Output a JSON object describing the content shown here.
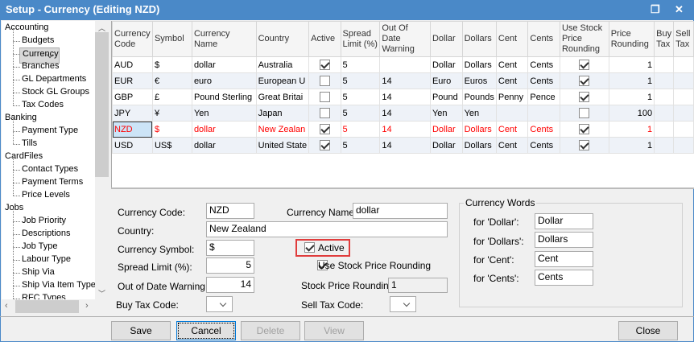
{
  "window": {
    "title": "Setup - Currency (Editing NZD)",
    "restore_icon": "restore-icon",
    "close_icon": "close-icon"
  },
  "sidebar": {
    "items": [
      {
        "label": "Accounting",
        "level": 0
      },
      {
        "label": "Budgets",
        "level": 1
      },
      {
        "label": "Currency",
        "level": 1,
        "selected": true
      },
      {
        "label": "Branches",
        "level": 1
      },
      {
        "label": "GL Departments",
        "level": 1
      },
      {
        "label": "Stock GL Groups",
        "level": 1
      },
      {
        "label": "Tax Codes",
        "level": 1
      },
      {
        "label": "Banking",
        "level": 0
      },
      {
        "label": "Payment Type",
        "level": 1
      },
      {
        "label": "Tills",
        "level": 1
      },
      {
        "label": "CardFiles",
        "level": 0
      },
      {
        "label": "Contact Types",
        "level": 1
      },
      {
        "label": "Payment Terms",
        "level": 1
      },
      {
        "label": "Price Levels",
        "level": 1
      },
      {
        "label": "Jobs",
        "level": 0
      },
      {
        "label": "Job Priority",
        "level": 1
      },
      {
        "label": "Descriptions",
        "level": 1
      },
      {
        "label": "Job Type",
        "level": 1
      },
      {
        "label": "Labour Type",
        "level": 1
      },
      {
        "label": "Ship Via",
        "level": 1
      },
      {
        "label": "Ship Via Item Types",
        "level": 1
      },
      {
        "label": "RFC Types",
        "level": 1
      }
    ]
  },
  "grid": {
    "columns": [
      "Currency Code",
      "Symbol",
      "Currency Name",
      "Country",
      "Active",
      "Spread Limit (%)",
      "Out Of Date Warning",
      "Dollar",
      "Dollars",
      "Cent",
      "Cents",
      "Use Stock Price Rounding",
      "Price Rounding",
      "Buy Tax",
      "Sell Tax"
    ],
    "rows": [
      {
        "code": "AUD",
        "symbol": "$",
        "name": "dollar",
        "country": "Australia",
        "active": true,
        "spread": "5",
        "ood": "",
        "dollar": "Dollar",
        "dollars": "Dollars",
        "cent": "Cent",
        "cents": "Cents",
        "use_stock": true,
        "rounding": "1",
        "buy": "",
        "sell": ""
      },
      {
        "code": "EUR",
        "symbol": "€",
        "name": "euro",
        "country": "European U",
        "active": false,
        "spread": "5",
        "ood": "14",
        "dollar": "Euro",
        "dollars": "Euros",
        "cent": "Cent",
        "cents": "Cents",
        "use_stock": true,
        "rounding": "1",
        "buy": "",
        "sell": ""
      },
      {
        "code": "GBP",
        "symbol": "£",
        "name": "Pound Sterling",
        "country": "Great Britai",
        "active": false,
        "spread": "5",
        "ood": "14",
        "dollar": "Pound",
        "dollars": "Pounds",
        "cent": "Penny",
        "cents": "Pence",
        "use_stock": true,
        "rounding": "1",
        "buy": "",
        "sell": ""
      },
      {
        "code": "JPY",
        "symbol": "¥",
        "name": "Yen",
        "country": "Japan",
        "active": false,
        "spread": "5",
        "ood": "14",
        "dollar": "Yen",
        "dollars": "Yen",
        "cent": "",
        "cents": "",
        "use_stock": false,
        "rounding": "100",
        "buy": "",
        "sell": ""
      },
      {
        "code": "NZD",
        "symbol": "$",
        "name": "dollar",
        "country": "New Zealan",
        "active": true,
        "spread": "5",
        "ood": "14",
        "dollar": "Dollar",
        "dollars": "Dollars",
        "cent": "Cent",
        "cents": "Cents",
        "use_stock": true,
        "rounding": "1",
        "buy": "",
        "sell": "",
        "editing": true
      },
      {
        "code": "USD",
        "symbol": "US$",
        "name": "dollar",
        "country": "United State",
        "active": true,
        "spread": "5",
        "ood": "14",
        "dollar": "Dollar",
        "dollars": "Dollars",
        "cent": "Cent",
        "cents": "Cents",
        "use_stock": true,
        "rounding": "1",
        "buy": "",
        "sell": ""
      }
    ]
  },
  "details": {
    "currency_code_label": "Currency Code:",
    "currency_code": "NZD",
    "currency_name_label": "Currency Name:",
    "currency_name": "dollar",
    "country_label": "Country:",
    "country": "New Zealand",
    "currency_symbol_label": "Currency Symbol:",
    "currency_symbol": "$",
    "active_label": "Active",
    "active": true,
    "spread_label": "Spread Limit (%):",
    "spread": "5",
    "use_stock_label": "Use Stock Price Rounding",
    "use_stock": true,
    "ood_label": "Out of Date Warning:",
    "ood": "14",
    "stock_rounding_label": "Stock Price Rounding:",
    "stock_rounding": "1",
    "buy_tax_label": "Buy Tax Code:",
    "buy_tax": "",
    "sell_tax_label": "Sell Tax Code:",
    "sell_tax": ""
  },
  "words": {
    "title": "Currency Words",
    "dollar_label": "for 'Dollar':",
    "dollar": "Dollar",
    "dollars_label": "for 'Dollars':",
    "dollars": "Dollars",
    "cent_label": "for 'Cent':",
    "cent": "Cent",
    "cents_label": "for 'Cents':",
    "cents": "Cents"
  },
  "buttons": {
    "save": "Save",
    "cancel": "Cancel",
    "delete": "Delete",
    "view": "View",
    "close": "Close"
  },
  "colors": {
    "title_bar": "#4a89c8",
    "highlight_red": "#ff0000"
  }
}
